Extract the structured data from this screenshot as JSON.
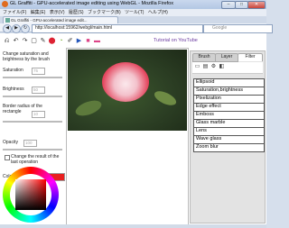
{
  "window": {
    "title": "GL Graffiti - GPU-accelerated image editing using WebGL - Mozilla Firefox",
    "min": "–",
    "max": "□",
    "close": "✕"
  },
  "menu": [
    "ファイル(F)",
    "編集(E)",
    "表示(V)",
    "履歴(S)",
    "ブックマーク(B)",
    "ツール(T)",
    "ヘルプ(H)"
  ],
  "tab": {
    "label": "GL Graffiti - GPU-accelerated image edit..."
  },
  "nav": {
    "back": "◀",
    "forward": "▶",
    "reload": "↻",
    "url": "http://localhost:15962/webgl/main.html",
    "search_placeholder": "Google"
  },
  "toolbar": {
    "icons": [
      "⎌",
      "↶",
      "↷",
      "▢",
      "✎",
      "⬤",
      "◔",
      "✐",
      "▶",
      "■",
      "▬"
    ]
  },
  "tutorial_link": "Tutorial on YouTube",
  "left": {
    "desc": "Change saturation and brightness by the brush",
    "saturation_label": "Saturation",
    "saturation_value": "75",
    "brightness_label": "Brightness",
    "brightness_value": "50",
    "border_label": "Border radius of the rectangle",
    "border_value": "10",
    "opacity_label": "Opacity",
    "opacity_value": "100",
    "change_result_label": "Change the result of the last operation",
    "color_label": "Color",
    "color_value": "#e81f1f"
  },
  "right": {
    "tabs": [
      "Brush",
      "Layer",
      "Filter"
    ],
    "filter_icons": [
      "▭",
      "▤",
      "⚙",
      "◧"
    ],
    "filters": [
      "Ellipsoid",
      "Saturation,brightness",
      "Pixelization",
      "Edge effect",
      "Emboss",
      "Glass marble",
      "Lens",
      "Wave glass",
      "Zoom blur"
    ]
  },
  "colors": {
    "accent": "#e81f1f",
    "link": "#6a3aa0"
  }
}
